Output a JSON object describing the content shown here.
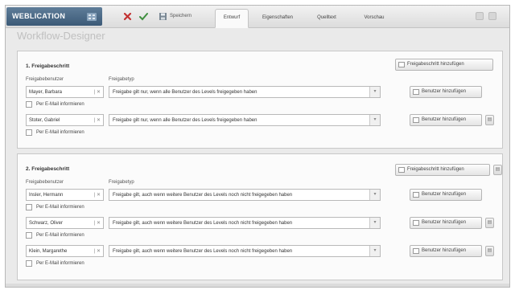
{
  "app": {
    "brand": "WEBLICATION",
    "save_label": "Speichern"
  },
  "tabs": [
    {
      "label": "Entwurf",
      "active": true
    },
    {
      "label": "Eigenschaften",
      "active": false
    },
    {
      "label": "Quelltext",
      "active": false
    },
    {
      "label": "Vorschau",
      "active": false
    }
  ],
  "page_title": "Workflow-Designer",
  "labels": {
    "user_col": "Freigabebenutzer",
    "type_col": "Freigabetyp",
    "email": "Per E-Mail informieren",
    "add_step": "Freigabeschritt hinzufügen",
    "add_user": "Benutzer hinzufügen",
    "user_actions": "| ✕"
  },
  "steps": [
    {
      "title": "1. Freigabeschritt",
      "rows": [
        {
          "user": "Mayer, Barbara",
          "type": "Freigabe gilt nur, wenn alle Benutzer des Levels freigegeben haben"
        },
        {
          "user": "Stoter, Gabriel",
          "type": "Freigabe gilt nur, wenn alle Benutzer des Levels freigegeben haben"
        }
      ]
    },
    {
      "title": "2. Freigabeschritt",
      "rows": [
        {
          "user": "Insler, Hermann",
          "type": "Freigabe gilt, auch wenn weitere Benutzer des Levels noch nicht freigegeben haben"
        },
        {
          "user": "Schwarz, Oliver",
          "type": "Freigabe gilt, auch wenn weitere Benutzer des Levels noch nicht freigegeben haben"
        },
        {
          "user": "Klein, Margarethe",
          "type": "Freigabe gilt, auch wenn weitere Benutzer des Levels noch nicht freigegeben haben"
        }
      ]
    }
  ],
  "colors": {
    "brand_bg": "#4a6986",
    "delete": "#c33333",
    "accent_green": "#3f8f3f"
  }
}
